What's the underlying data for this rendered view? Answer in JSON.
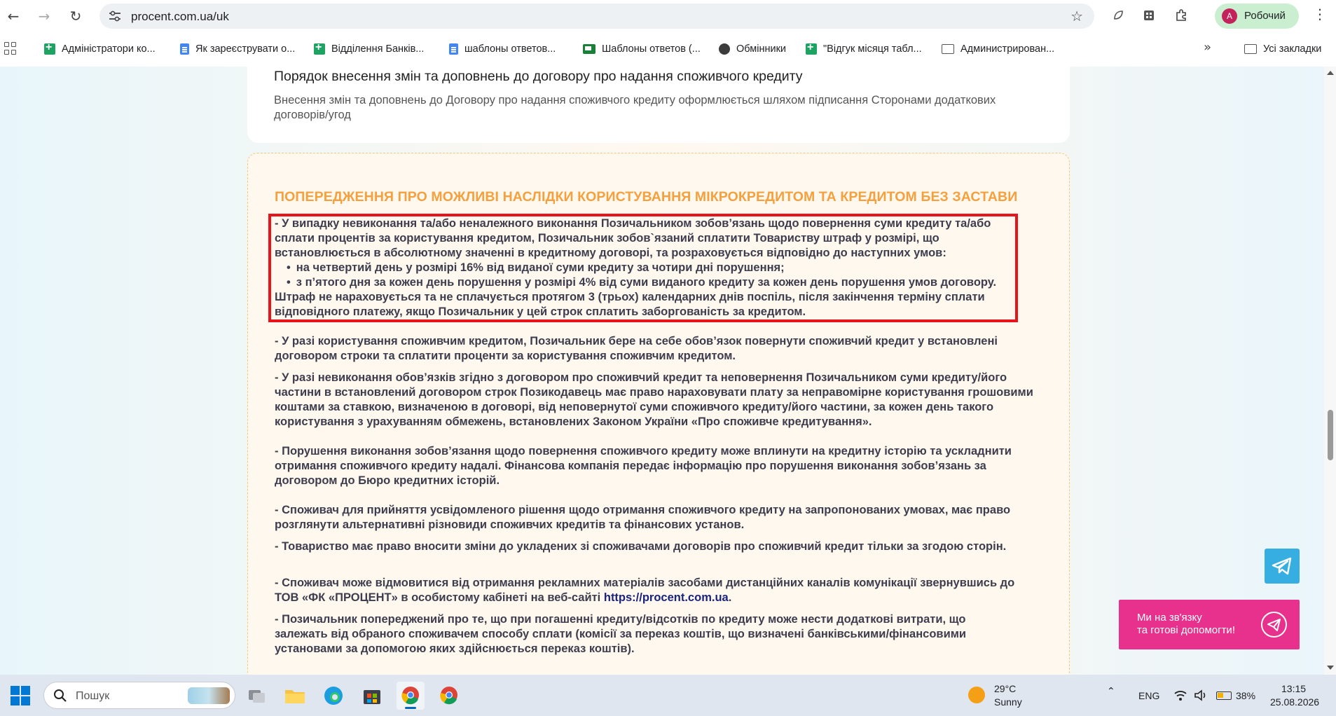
{
  "browser": {
    "url": "procent.com.ua/uk",
    "profile_initial": "А",
    "profile_name": "Робочий",
    "bookmarks": [
      {
        "label": "Адміністратори ко...",
        "icon": "sheets-icon"
      },
      {
        "label": "Як зареєструвати о...",
        "icon": "docs-icon"
      },
      {
        "label": "Відділення Банків...",
        "icon": "sheets-icon"
      },
      {
        "label": "шаблоны ответов...",
        "icon": "docs-icon"
      },
      {
        "label": "Шаблоны ответов (...",
        "icon": "slides-icon"
      },
      {
        "label": "Обмінники",
        "icon": "globe-icon"
      },
      {
        "label": "\"Відгук місяця табл...",
        "icon": "sheets-icon"
      },
      {
        "label": "Администрирован...",
        "icon": "folder-icon"
      }
    ],
    "all_bookmarks": "Усі закладки"
  },
  "page": {
    "top_card": {
      "title": "Порядок внесення змін та доповнень до договору про надання споживчого кредиту",
      "body": "Внесення змін та доповнень до Договору про надання споживчого кредиту оформлюється шляхом підписання Сторонами додаткових договорів/угод"
    },
    "warning": {
      "title": "ПОПЕРЕДЖЕННЯ ПРО МОЖЛИВІ НАСЛІДКИ КОРИСТУВАННЯ МІКРОКРЕДИТОМ ТА КРЕДИТОМ БЕЗ ЗАСТАВИ",
      "p1_intro_lines": [
        "- У випадку невиконання та/або неналежного виконання Позичальником зобов’язань щодо повернення суми кредиту та/або",
        "сплати процентів за користування кредитом, Позичальник зобов`язаний сплатити Товариству штраф у розмірі, що",
        "встановлюється в абсолютному значенні в кредитному договорі, та розраховується відповідно до наступних умов:"
      ],
      "p1_bullets": [
        "на четвертий день у розмірі 16% від виданої суми кредиту за чотири дні порушення;",
        "з п’ятого дня за кожен день порушення у розмірі 4% від суми виданого кредиту за кожен день порушення умов договору."
      ],
      "p1_tail_lines": [
        "Штраф не нараховується та не сплачується протягом 3 (трьох) календарних днів поспіль, після закінчення терміну сплати",
        "відповідного платежу, якщо Позичальник у цей строк сплатить заборгованість за кредитом."
      ],
      "p2_lines": [
        "- У разі користування споживчим кредитом, Позичальник бере на себе обов’язок повернути споживчий кредит у встановлені",
        "договором строки та сплатити проценти за користування споживчим кредитом."
      ],
      "p3_lines": [
        "- У разі невиконання обов’язків згідно з договором про споживчий кредит та неповернення Позичальником суми кредиту/його",
        "частини в встановлений договором строк Позикодавець має право нараховувати плату за неправомірне користування грошовими",
        "коштами за ставкою, визначеною в договорі, від неповернутої суми споживчого кредиту/його частини, за кожен день такого",
        "користування з урахуванням обмежень, встановлених Законом України «Про споживче кредитування»."
      ],
      "p4_lines": [
        "- Порушення виконання зобов’язання щодо повернення споживчого кредиту може вплинути на кредитну історію та ускладнити",
        "отримання споживчого кредиту надалі. Фінансова компанія передає інформацію про порушення виконання зобов’язань за",
        "договором до Бюро кредитних історій."
      ],
      "p5_lines": [
        "- Споживач для прийняття усвідомленого рішення щодо отримання споживчого кредиту на запропонованих умовах, має право",
        "розглянути альтернативні різновиди споживчих кредитів та фінансових установ."
      ],
      "p6_lines": [
        "- Товариство має право вносити зміни до укладених зі споживачами договорів про споживчий кредит тільки за згодою сторін."
      ],
      "p7_line1": "- Споживач може відмовитися від отримання рекламних матеріалів засобами дистанційних каналів комунікації звернувшись до",
      "p7_line2_prefix": "ТОВ «ФК «ПРОЦЕНТ» в особистому кабінеті на веб-сайті ",
      "p7_link": "https://procent.com.ua",
      "p7_line2_suffix": ".",
      "p8_lines": [
        "- Позичальник попереджений про те, що при погашенні кредиту/відсотків по кредиту може нести додаткові витрати, що",
        "залежать від обраного споживачем способу сплати (комісії за переказ коштів, що визначені банківськими/фінансовими",
        "установами за допомогою яких здійснюється переказ коштів)."
      ]
    },
    "help_banner": "Ми на зв'язку\nта готові допомогти!"
  },
  "taskbar": {
    "search_placeholder": "Пошук",
    "weather_temp": "29°C",
    "weather_condition": "Sunny",
    "language": "ENG",
    "battery": "38%",
    "time": "13:15",
    "date": "25.08.2026"
  },
  "colors": {
    "accent_orange": "#f5a03c",
    "highlight_red": "#e8141c",
    "pink_banner": "#e8318c",
    "telegram_blue": "#37aee2"
  }
}
